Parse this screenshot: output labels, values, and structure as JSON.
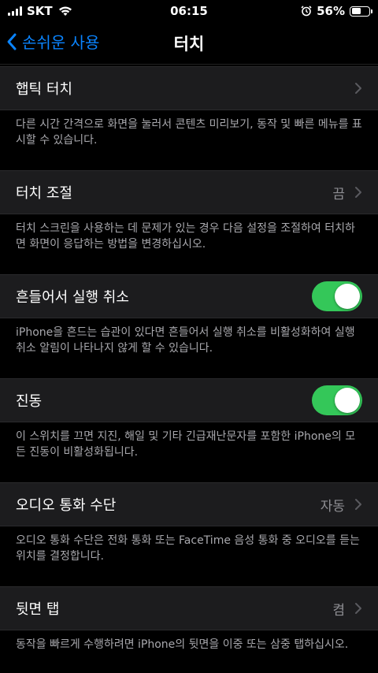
{
  "status": {
    "carrier": "SKT",
    "time": "06:15",
    "battery": "56%",
    "battery_level": 0.56
  },
  "nav": {
    "back_label": "손쉬운 사용",
    "title": "터치"
  },
  "sections": {
    "haptic": {
      "label": "햅틱 터치",
      "footer": "다른 시간 간격으로 화면을 눌러서 콘텐츠 미리보기, 동작 및 빠른 메뉴를 표시할 수 있습니다."
    },
    "accommodations": {
      "label": "터치 조절",
      "value": "끔",
      "footer": "터치 스크린을 사용하는 데 문제가 있는 경우 다음 설정을 조절하여 터치하면 화면이 응답하는 방법을 변경하십시오."
    },
    "shake": {
      "label": "흔들어서 실행 취소",
      "on": true,
      "footer": "iPhone을 흔드는 습관이 있다면 흔들어서 실행 취소를 비활성화하여 실행 취소 알림이 나타나지 않게 할 수 있습니다."
    },
    "vibration": {
      "label": "진동",
      "on": true,
      "footer": "이 스위치를 끄면 지진, 해일 및 기타 긴급재난문자를 포함한 iPhone의 모든 진동이 비활성화됩니다."
    },
    "audio": {
      "label": "오디오 통화 수단",
      "value": "자동",
      "footer": "오디오 통화 수단은 전화 통화 또는 FaceTime 음성 통화 중 오디오를 듣는 위치를 결정합니다."
    },
    "backtap": {
      "label": "뒷면 탭",
      "value": "켬",
      "footer": "동작을 빠르게 수행하려면 iPhone의 뒷면을 이중 또는 삼중 탭하십시오."
    }
  },
  "colors": {
    "accent": "#0a84ff",
    "toggle_on": "#34c759",
    "cell_bg": "#1c1c1e"
  }
}
